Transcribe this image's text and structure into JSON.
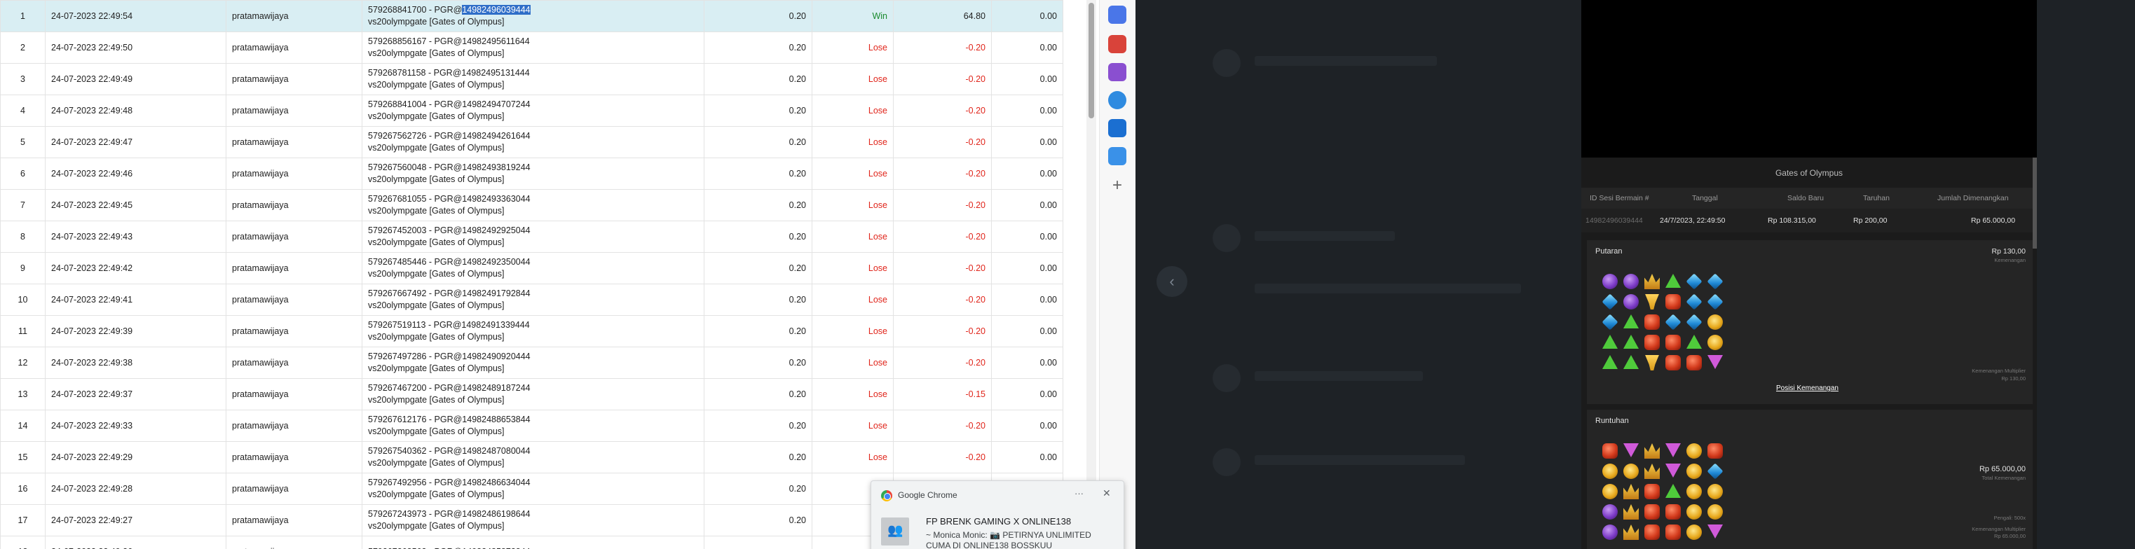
{
  "transactions": {
    "rows": [
      {
        "no": "1",
        "time": "24-07-2023 22:49:54",
        "user": "pratamawijaya",
        "round_prefix": "579268841700 - PGR@",
        "round_hl": "14982496039444",
        "round_suffix": "",
        "game": "vs20olympgate [Gates of Olympus]",
        "bet": "0.20",
        "result": "Win",
        "winloss": "64.80",
        "jp": "0.00"
      },
      {
        "no": "2",
        "time": "24-07-2023 22:49:50",
        "user": "pratamawijaya",
        "round_prefix": "579268856167 - PGR@14982495611644",
        "round_hl": "",
        "round_suffix": "",
        "game": "vs20olympgate [Gates of Olympus]",
        "bet": "0.20",
        "result": "Lose",
        "winloss": "-0.20",
        "jp": "0.00"
      },
      {
        "no": "3",
        "time": "24-07-2023 22:49:49",
        "user": "pratamawijaya",
        "round_prefix": "579268781158 - PGR@14982495131444",
        "round_hl": "",
        "round_suffix": "",
        "game": "vs20olympgate [Gates of Olympus]",
        "bet": "0.20",
        "result": "Lose",
        "winloss": "-0.20",
        "jp": "0.00"
      },
      {
        "no": "4",
        "time": "24-07-2023 22:49:48",
        "user": "pratamawijaya",
        "round_prefix": "579268841004 - PGR@14982494707244",
        "round_hl": "",
        "round_suffix": "",
        "game": "vs20olympgate [Gates of Olympus]",
        "bet": "0.20",
        "result": "Lose",
        "winloss": "-0.20",
        "jp": "0.00"
      },
      {
        "no": "5",
        "time": "24-07-2023 22:49:47",
        "user": "pratamawijaya",
        "round_prefix": "579267562726 - PGR@14982494261644",
        "round_hl": "",
        "round_suffix": "",
        "game": "vs20olympgate [Gates of Olympus]",
        "bet": "0.20",
        "result": "Lose",
        "winloss": "-0.20",
        "jp": "0.00"
      },
      {
        "no": "6",
        "time": "24-07-2023 22:49:46",
        "user": "pratamawijaya",
        "round_prefix": "579267560048 - PGR@14982493819244",
        "round_hl": "",
        "round_suffix": "",
        "game": "vs20olympgate [Gates of Olympus]",
        "bet": "0.20",
        "result": "Lose",
        "winloss": "-0.20",
        "jp": "0.00"
      },
      {
        "no": "7",
        "time": "24-07-2023 22:49:45",
        "user": "pratamawijaya",
        "round_prefix": "579267681055 - PGR@14982493363044",
        "round_hl": "",
        "round_suffix": "",
        "game": "vs20olympgate [Gates of Olympus]",
        "bet": "0.20",
        "result": "Lose",
        "winloss": "-0.20",
        "jp": "0.00"
      },
      {
        "no": "8",
        "time": "24-07-2023 22:49:43",
        "user": "pratamawijaya",
        "round_prefix": "579267452003 - PGR@14982492925044",
        "round_hl": "",
        "round_suffix": "",
        "game": "vs20olympgate [Gates of Olympus]",
        "bet": "0.20",
        "result": "Lose",
        "winloss": "-0.20",
        "jp": "0.00"
      },
      {
        "no": "9",
        "time": "24-07-2023 22:49:42",
        "user": "pratamawijaya",
        "round_prefix": "579267485446 - PGR@14982492350044",
        "round_hl": "",
        "round_suffix": "",
        "game": "vs20olympgate [Gates of Olympus]",
        "bet": "0.20",
        "result": "Lose",
        "winloss": "-0.20",
        "jp": "0.00"
      },
      {
        "no": "10",
        "time": "24-07-2023 22:49:41",
        "user": "pratamawijaya",
        "round_prefix": "579267667492 - PGR@14982491792844",
        "round_hl": "",
        "round_suffix": "",
        "game": "vs20olympgate [Gates of Olympus]",
        "bet": "0.20",
        "result": "Lose",
        "winloss": "-0.20",
        "jp": "0.00"
      },
      {
        "no": "11",
        "time": "24-07-2023 22:49:39",
        "user": "pratamawijaya",
        "round_prefix": "579267519113 - PGR@14982491339444",
        "round_hl": "",
        "round_suffix": "",
        "game": "vs20olympgate [Gates of Olympus]",
        "bet": "0.20",
        "result": "Lose",
        "winloss": "-0.20",
        "jp": "0.00"
      },
      {
        "no": "12",
        "time": "24-07-2023 22:49:38",
        "user": "pratamawijaya",
        "round_prefix": "579267497286 - PGR@14982490920444",
        "round_hl": "",
        "round_suffix": "",
        "game": "vs20olympgate [Gates of Olympus]",
        "bet": "0.20",
        "result": "Lose",
        "winloss": "-0.20",
        "jp": "0.00"
      },
      {
        "no": "13",
        "time": "24-07-2023 22:49:37",
        "user": "pratamawijaya",
        "round_prefix": "579267467200 - PGR@14982489187244",
        "round_hl": "",
        "round_suffix": "",
        "game": "vs20olympgate [Gates of Olympus]",
        "bet": "0.20",
        "result": "Lose",
        "winloss": "-0.15",
        "jp": "0.00"
      },
      {
        "no": "14",
        "time": "24-07-2023 22:49:33",
        "user": "pratamawijaya",
        "round_prefix": "579267612176 - PGR@14982488653844",
        "round_hl": "",
        "round_suffix": "",
        "game": "vs20olympgate [Gates of Olympus]",
        "bet": "0.20",
        "result": "Lose",
        "winloss": "-0.20",
        "jp": "0.00"
      },
      {
        "no": "15",
        "time": "24-07-2023 22:49:29",
        "user": "pratamawijaya",
        "round_prefix": "579267540362 - PGR@14982487080044",
        "round_hl": "",
        "round_suffix": "",
        "game": "vs20olympgate [Gates of Olympus]",
        "bet": "0.20",
        "result": "Lose",
        "winloss": "-0.20",
        "jp": "0.00"
      },
      {
        "no": "16",
        "time": "24-07-2023 22:49:28",
        "user": "pratamawijaya",
        "round_prefix": "579267492956 - PGR@14982486634044",
        "round_hl": "",
        "round_suffix": "",
        "game": "vs20olympgate [Gates of Olympus]",
        "bet": "0.20",
        "result": "",
        "winloss": "",
        "jp": ""
      },
      {
        "no": "17",
        "time": "24-07-2023 22:49:27",
        "user": "pratamawijaya",
        "round_prefix": "579267243973 - PGR@14982486198644",
        "round_hl": "",
        "round_suffix": "",
        "game": "vs20olympgate [Gates of Olympus]",
        "bet": "0.20",
        "result": "",
        "winloss": "",
        "jp": ""
      },
      {
        "no": "18",
        "time": "24-07-2023 22:49:26",
        "user": "pratamawijaya",
        "round_prefix": "579267268562 - PGR@14982485872844",
        "round_hl": "",
        "round_suffix": "",
        "game": "",
        "bet": "",
        "result": "",
        "winloss": "",
        "jp": ""
      }
    ]
  },
  "colors": {
    "win": "#1a8a2e",
    "lose": "#e0251b",
    "selected_row": "#d9eef3"
  },
  "sidebar_icons": [
    "bag-icon",
    "toolbox-icon",
    "games-icon",
    "office-icon",
    "outlook-icon",
    "cart-icon",
    "plus-icon"
  ],
  "game_history": {
    "title": "Gates of Olympus",
    "headers": [
      "ID Sesi Bermain #",
      "Tanggal",
      "Saldo Baru",
      "Taruhan",
      "Jumlah Dimenangkan"
    ],
    "row": [
      "14982496039444",
      "24/7/2023, 22:49:50",
      "Rp 108.315,00",
      "Rp 200,00",
      "Rp 65.000,00"
    ],
    "spin": {
      "title": "Putaran",
      "amount": "Rp 130,00",
      "amount_label": "Kemenangan",
      "win_label": "Kemenangan Multiplier",
      "win_value": "Rp 130,00",
      "link": "Posisi Kemenangan"
    },
    "tumble": {
      "title": "Runtuhan",
      "amount": "Rp 65.000,00",
      "amount_label": "Total Kemenangan",
      "multiplier_label": "Pengali: 500x",
      "win_label": "Kemenangan Multiplier",
      "win_value": "Rp 65.000,00"
    }
  },
  "notification": {
    "app": "Google Chrome",
    "more": "···",
    "close": "✕",
    "title": "FP BRENK GAMING X ONLINE138",
    "body": "~ Monica Monic: 📷 PETIRNYA UNLIMITED CUMA DI ONLINE138 BOSSKUU"
  },
  "back_arrow": "‹"
}
